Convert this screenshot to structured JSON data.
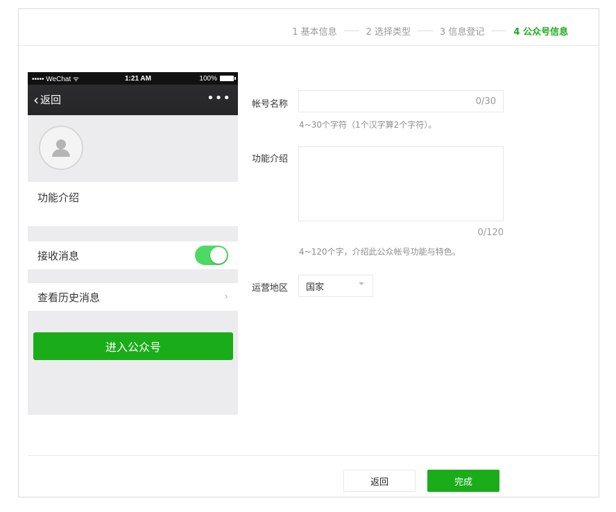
{
  "steps": [
    {
      "label": "1 基本信息"
    },
    {
      "label": "2 选择类型"
    },
    {
      "label": "3 信息登记"
    },
    {
      "label": "4 公众号信息"
    }
  ],
  "phone": {
    "status": {
      "carrier": "••••• WeChat ᯤ",
      "time": "1:21 AM",
      "battery": "100%"
    },
    "nav": {
      "back_label": "返回",
      "more": "•••"
    },
    "intro_label": "功能介绍",
    "receive_label": "接收消息",
    "history_label": "查看历史消息",
    "history_chevron": "›",
    "enter_button": "进入公众号",
    "toggle_on": true
  },
  "form": {
    "name_label": "帐号名称",
    "name_value": "",
    "name_counter": "0/30",
    "name_hint": "4~30个字符（1个汉字算2个字符）。",
    "desc_label": "功能介绍",
    "desc_value": "",
    "desc_counter": "0/120",
    "desc_hint": "4~120个字，介绍此公众帐号功能与特色。",
    "region_label": "运营地区",
    "region_value": "国家"
  },
  "footer": {
    "back_button": "返回",
    "done_button": "完成"
  },
  "colors": {
    "accent": "#1aad19",
    "toggle": "#4cd964",
    "nav_bg": "#262628"
  }
}
